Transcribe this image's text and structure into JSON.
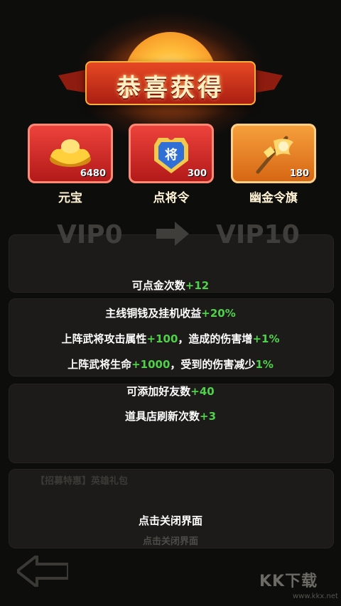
{
  "title": "恭喜获得",
  "rewards": [
    {
      "name": "元宝",
      "quantity": "6480",
      "icon": "gold-ingot-icon"
    },
    {
      "name": "点将令",
      "quantity": "300",
      "icon": "general-token-icon"
    },
    {
      "name": "幽金令旗",
      "quantity": "180",
      "icon": "command-flag-icon"
    }
  ],
  "vip": {
    "from": "VIP0",
    "to": "VIP10"
  },
  "benefits": [
    {
      "text": "可点金次数",
      "bonus": "+12"
    },
    {
      "text": "主线铜钱及挂机收益",
      "bonus": "+20%"
    },
    {
      "text": "上阵武将攻击属性",
      "bonus": "+100",
      "text2": "，造成的伤害增",
      "bonus2": "+1%"
    },
    {
      "text": "上阵武将生命",
      "bonus": "+1000",
      "text2": "，受到的伤害减少",
      "bonus2": "1%"
    },
    {
      "text": "可添加好友数",
      "bonus": "+40"
    },
    {
      "text": "道具店刷新次数",
      "bonus": "+3"
    }
  ],
  "close_hint": "点击关闭界面",
  "background": {
    "close_hint": "点击关闭界面",
    "pack_label": "【招募特惠】英雄礼包"
  },
  "watermark": {
    "brand": "KK下载",
    "url": "www.kkx.net"
  },
  "colors": {
    "bonus": "#4fd14a",
    "banner": "#d9391d",
    "card_red": "#e03030",
    "card_orange": "#f08a2a"
  }
}
